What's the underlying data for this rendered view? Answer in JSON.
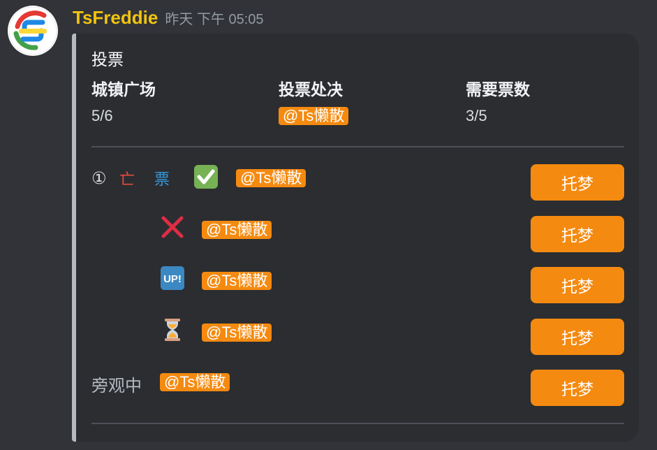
{
  "message": {
    "username": "TsFreddie",
    "timestamp": "昨天 下午 05:05"
  },
  "embed": {
    "title": "投票",
    "fields": [
      {
        "name": "城镇广场",
        "value": "5/6"
      },
      {
        "name": "投票处决",
        "value": "@Ts懒散"
      },
      {
        "name": "需要票数",
        "value": "3/5"
      }
    ],
    "rows": [
      {
        "number": "①",
        "status": "亡",
        "ballot": "票",
        "emoji": "check-mark-icon",
        "mention": "@Ts懒散",
        "button": "托梦"
      },
      {
        "emoji": "cross-mark-icon",
        "mention": "@Ts懒散",
        "button": "托梦"
      },
      {
        "emoji": "up-icon",
        "mention": "@Ts懒散",
        "button": "托梦"
      },
      {
        "emoji": "hourglass-icon",
        "mention": "@Ts懒散",
        "button": "托梦"
      }
    ],
    "spectators": {
      "label": "旁观中",
      "mention": "@Ts懒散",
      "button": "托梦"
    }
  },
  "colors": {
    "username": "#f1c40f",
    "accent": "#f58a10",
    "background": "#313338",
    "embed": "#2b2d31"
  }
}
